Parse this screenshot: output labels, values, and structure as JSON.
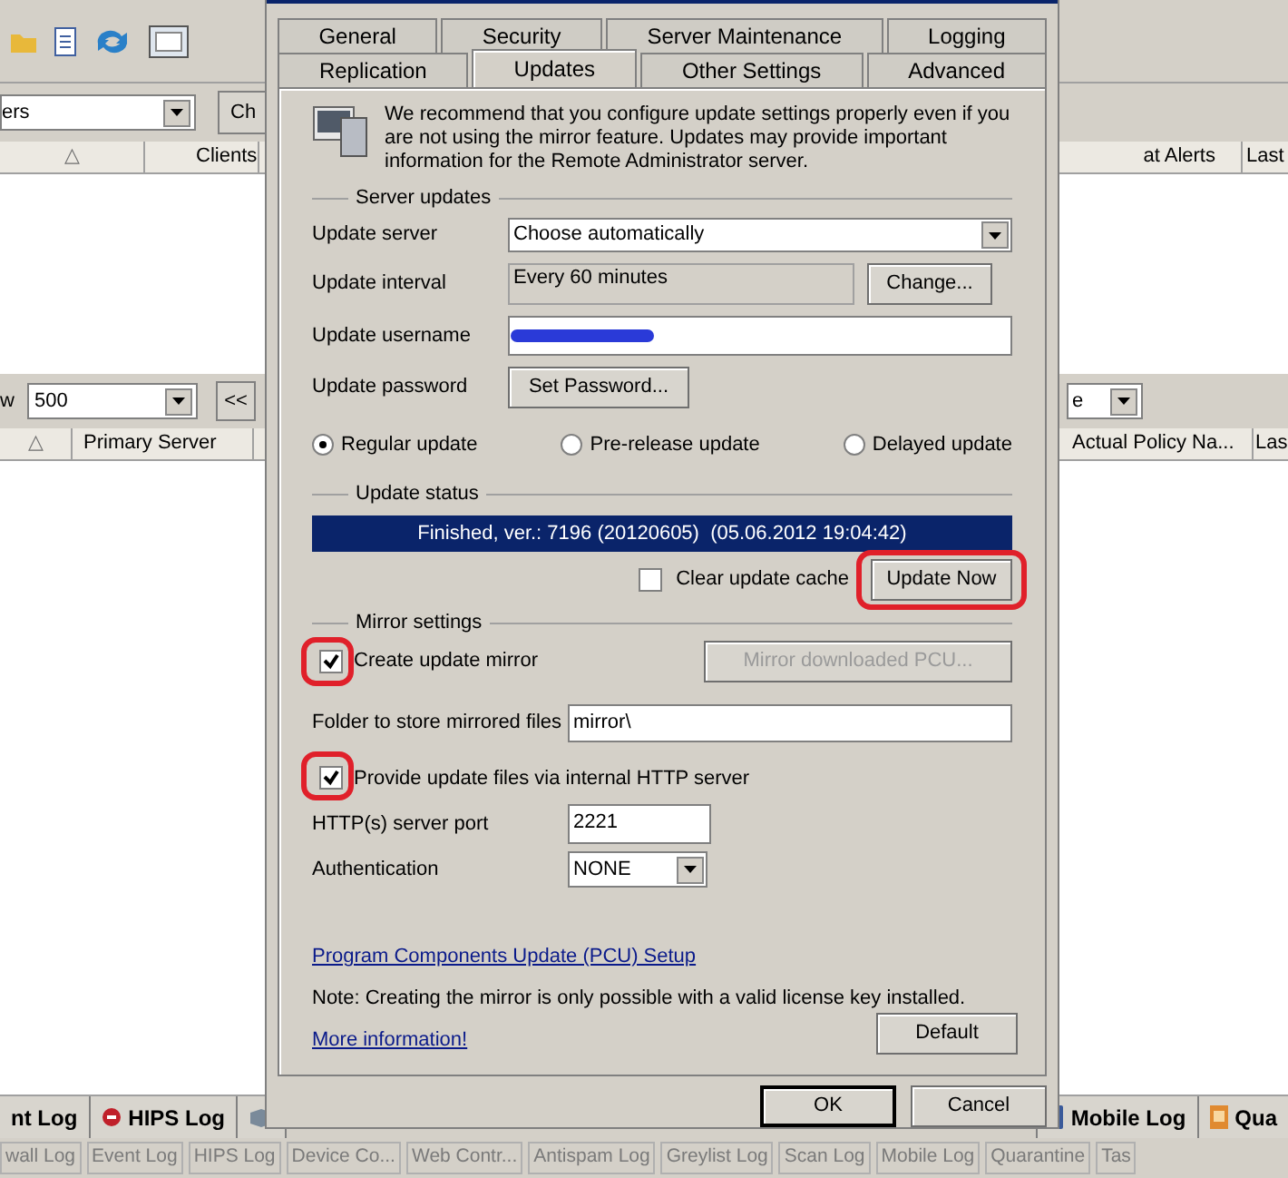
{
  "background": {
    "filter_value": "ers",
    "filter_button": "Ch",
    "top_columns_left": [
      {
        "label": "△",
        "kind": "sort"
      },
      {
        "label": "Clients",
        "kind": "text"
      }
    ],
    "top_columns_right": [
      "at Alerts",
      "Last"
    ],
    "rows_label": "w",
    "rows_value": "500",
    "page_button": "<<",
    "right_filter_value": "e",
    "bottom_columns_left": [
      {
        "label": "△",
        "kind": "sort"
      },
      {
        "label": "Primary Server",
        "kind": "text"
      }
    ],
    "bottom_columns_right": [
      "Actual Policy Na...",
      "Las"
    ],
    "log_tabs_left": [
      {
        "label": "nt Log",
        "kind": "plain"
      },
      {
        "label": "HIPS Log",
        "kind": "hips"
      },
      {
        "kind": "devices"
      }
    ],
    "log_tabs_right": [
      {
        "label": "Mobile Log",
        "kind": "mobile"
      },
      {
        "label": "Qua",
        "kind": "quarantine"
      }
    ],
    "status_items": [
      "wall Log",
      "Event Log",
      "HIPS Log",
      "Device Co...",
      "Web Contr...",
      "Antispam Log",
      "Greylist Log",
      "Scan Log",
      "Mobile Log",
      "Quarantine",
      "Tas"
    ]
  },
  "dialog": {
    "tab_rows": [
      [
        {
          "label": "General",
          "selected": false
        },
        {
          "label": "Security",
          "selected": false
        },
        {
          "label": "Server Maintenance",
          "selected": false
        },
        {
          "label": "Logging",
          "selected": false
        }
      ],
      [
        {
          "label": "Replication",
          "selected": false
        },
        {
          "label": "Updates",
          "selected": true
        },
        {
          "label": "Other Settings",
          "selected": false
        },
        {
          "label": "Advanced",
          "selected": false
        }
      ]
    ],
    "intro": "We recommend that you configure update settings properly even if you are not using the mirror feature. Updates may provide important information for the Remote Administrator server.",
    "server_updates": {
      "title": "Server updates",
      "update_server_label": "Update server",
      "update_server_value": "Choose automatically",
      "interval_label": "Update interval",
      "interval_value": "Every 60 minutes",
      "change_button": "Change...",
      "username_label": "Update username",
      "password_label": "Update password",
      "set_password_button": "Set Password...",
      "update_types": [
        {
          "label": "Regular update",
          "selected": true
        },
        {
          "label": "Pre-release update",
          "selected": false
        },
        {
          "label": "Delayed update",
          "selected": false
        }
      ]
    },
    "update_status": {
      "title": "Update status",
      "status": "Finished, ver.: 7196 (20120605)  (05.06.2012 19:04:42)",
      "clear_cache": {
        "label": "Clear update cache",
        "checked": false
      },
      "update_now": {
        "label": "Update Now",
        "highlighted": true
      }
    },
    "mirror": {
      "title": "Mirror settings",
      "create_mirror": {
        "label": "Create update mirror",
        "checked": true,
        "highlighted": true
      },
      "pcu_button": {
        "label": "Mirror downloaded PCU...",
        "disabled": true
      },
      "folder_label": "Folder to store mirrored files",
      "folder_value": "mirror\\",
      "http": {
        "label": "Provide update files via internal HTTP server",
        "checked": true,
        "highlighted": true
      },
      "port_label": "HTTP(s) server port",
      "port_value": "2221",
      "auth_label": "Authentication",
      "auth_value": "NONE"
    },
    "pcu_link": "Program Components Update (PCU) Setup",
    "note": "Note: Creating the mirror is only possible with a valid license key installed.",
    "more_info": "More information!",
    "default_button": "Default",
    "buttons": [
      "OK",
      "Cancel"
    ]
  }
}
